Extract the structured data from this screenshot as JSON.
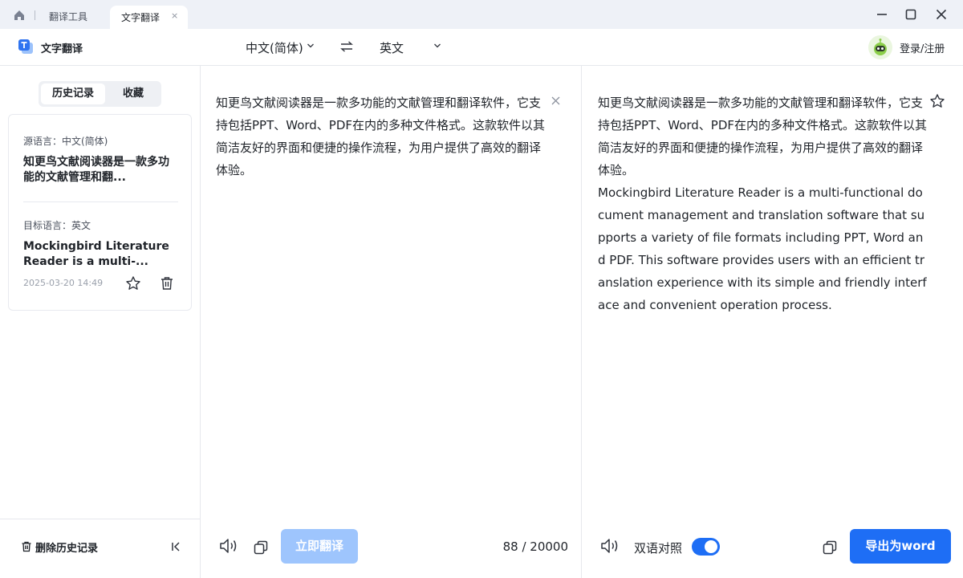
{
  "titlebar": {
    "tab_inactive": "翻译工具",
    "tab_active": "文字翻译",
    "tab_close": "×"
  },
  "header": {
    "app_title": "文字翻译",
    "source_lang": "中文(简体)",
    "target_lang": "英文",
    "login": "登录/注册"
  },
  "sidebar": {
    "tab_history": "历史记录",
    "tab_favorites": "收藏",
    "record": {
      "source_label": "源语言：中文(简体)",
      "source_text": "知更鸟文献阅读器是一款多功能的文献管理和翻...",
      "target_label": "目标语言：英文",
      "target_text": "Mockingbird Literature Reader is a multi-...",
      "time": "2025-03-20 14:49"
    },
    "clear_history": "删除历史记录"
  },
  "source": {
    "text": "知更鸟文献阅读器是一款多功能的文献管理和翻译软件，它支持包括PPT、Word、PDF在内的多种文件格式。这款软件以其简洁友好的界面和便捷的操作流程，为用户提供了高效的翻译体验。",
    "translate_button": "立即翻译",
    "char_count": "88 / 20000"
  },
  "target": {
    "text_cn": "知更鸟文献阅读器是一款多功能的文献管理和翻译软件，它支持包括PPT、Word、PDF在内的多种文件格式。这款软件以其简洁友好的界面和便捷的操作流程，为用户提供了高效的翻译体验。",
    "text_en": "Mockingbird Literature Reader is a multi-functional document management and translation software that supports a variety of file formats including PPT, Word and PDF. This software provides users with an efficient translation experience with its simple and friendly interface and convenient operation process.",
    "bilingual_label": "双语对照",
    "bilingual_on": true,
    "export_button": "导出为word"
  },
  "colors": {
    "accent": "#1e6ef5",
    "accent_disabled": "#9ec5fd",
    "titlebar_bg": "#eef1f7"
  }
}
